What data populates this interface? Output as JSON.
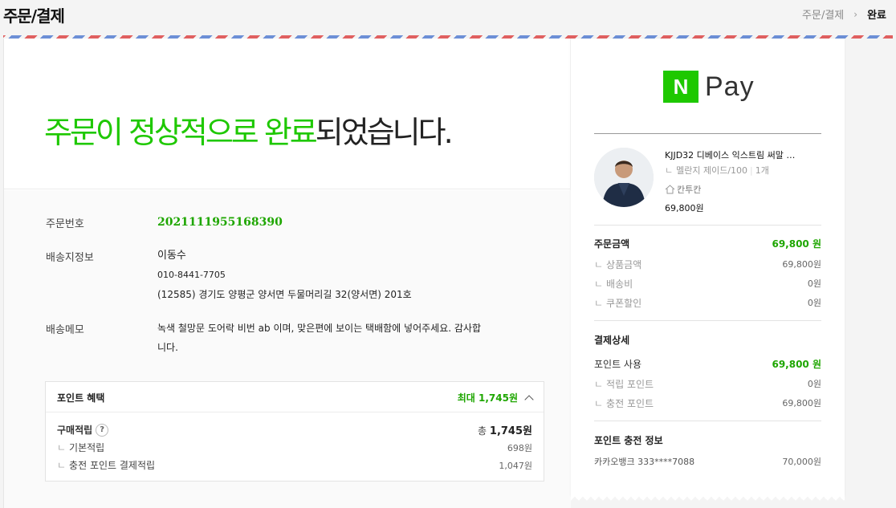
{
  "header": {
    "title": "주문/결제",
    "breadcrumb": [
      "주문/결제",
      "완료"
    ]
  },
  "colors": {
    "brand_green": "#1ec800",
    "text_green": "#1ea600"
  },
  "hero": {
    "message_highlight": "주문이 정상적으로 완료",
    "message_rest": "되었습니다."
  },
  "order": {
    "number_label": "주문번호",
    "number": "2021111955168390",
    "shipping_label": "배송지정보",
    "recipient": "이동수",
    "phone": "010-8441-7705",
    "address": "(12585) 경기도 양평군 양서면 두물머리길 32(양서면) 201호",
    "memo_label": "배송메모",
    "memo_line1": "녹색 철망문 도어락 비번 ab 이며, 맞은편에 보이는 택배함에 넣어주세요. 감사합",
    "memo_line2": "니다."
  },
  "points": {
    "title": "포인트 혜택",
    "max_label": "최대 1,745원",
    "purchase_label": "구매적립",
    "purchase_help": "?",
    "purchase_total_prefix": "총",
    "purchase_total": "1,745원",
    "items": [
      {
        "label": "기본적립",
        "value": "698원"
      },
      {
        "label": "충전 포인트 결제적립",
        "value": "1,047원"
      }
    ]
  },
  "receipt": {
    "pay_logo_letter": "N",
    "pay_logo_text": "Pay",
    "product": {
      "name": "KJJD32 디베이스 익스트림 써말 …",
      "option": "멜란지 제이드/100",
      "quantity": "1개",
      "shop": "칸투칸",
      "price": "69,800원"
    },
    "amount": {
      "label": "주문금액",
      "value": "69,800 원",
      "items": [
        {
          "label": "상품금액",
          "value": "69,800원"
        },
        {
          "label": "배송비",
          "value": "0원"
        },
        {
          "label": "쿠폰할인",
          "value": "0원"
        }
      ]
    },
    "payment": {
      "label": "결제상세",
      "point_label": "포인트 사용",
      "point_value": "69,800 원",
      "items": [
        {
          "label": "적립 포인트",
          "value": "0원"
        },
        {
          "label": "충전 포인트",
          "value": "69,800원"
        }
      ]
    },
    "charge": {
      "label": "포인트 충전 정보",
      "bank": "카카오뱅크 333****7088",
      "amount": "70,000원"
    }
  }
}
